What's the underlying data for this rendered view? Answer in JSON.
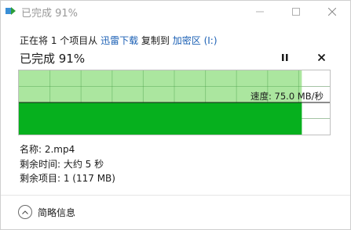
{
  "window": {
    "title": "已完成 91%",
    "minimize_icon": "minimize-icon",
    "maximize_icon": "maximize-icon",
    "close_icon": "close-icon"
  },
  "copy": {
    "prefix": "正在将 1 个项目从 ",
    "source": "迅雷下载",
    "middle": " 复制到 ",
    "destination": "加密区 (I:)"
  },
  "progress": {
    "header": "已完成 91%",
    "percent": 91,
    "speed_label": "速度: 75.0 MB/秒",
    "pause_icon": "pause-icon",
    "cancel_icon": "cancel-icon"
  },
  "details": {
    "name": "名称: 2.mp4",
    "time_remaining": "剩余时间: 大约 5 秒",
    "items_remaining": "剩余项目: 1 (117 MB)"
  },
  "footer": {
    "toggle_label": "简略信息",
    "toggle_icon": "chevron-up-icon"
  },
  "colors": {
    "progress_fill": "#a6e59a",
    "throughput_fill": "#06b01e",
    "link": "#1a5fb4"
  }
}
